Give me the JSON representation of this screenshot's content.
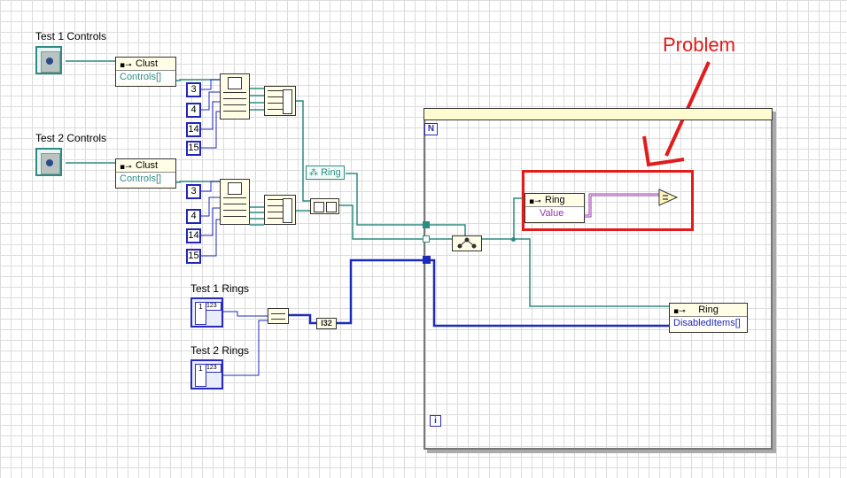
{
  "annotation": {
    "problem": "Problem"
  },
  "terminals": {
    "test1_controls": "Test 1 Controls",
    "test2_controls": "Test 2 Controls",
    "test1_rings": "Test 1 Rings",
    "test2_rings": "Test 2 Rings"
  },
  "property_nodes": {
    "clust1": {
      "class": "Clust",
      "property": "Controls[]"
    },
    "clust2": {
      "class": "Clust",
      "property": "Controls[]"
    },
    "ring_value": {
      "class": "Ring",
      "property": "Value"
    },
    "ring_disabled": {
      "class": "Ring",
      "property": "DisabledItems[]"
    }
  },
  "constants": {
    "group1": [
      "3",
      "4",
      "14",
      "15"
    ],
    "group2": [
      "3",
      "4",
      "14",
      "15"
    ]
  },
  "class_constant": "Ring",
  "conversion": "I32",
  "loop": {
    "count_terminal": "N",
    "iteration_terminal": "i"
  },
  "colors": {
    "wire_reference": "#2d8c82",
    "wire_integer": "#1f2ab8",
    "wire_variant": "#9933aa",
    "highlight": "#e21b1b"
  }
}
